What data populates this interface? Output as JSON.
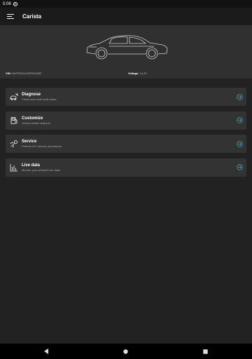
{
  "status_bar": {
    "time": "5:08"
  },
  "app_bar": {
    "title": "Carista",
    "menu_icon": "menu-icon"
  },
  "vehicle": {
    "vin_label": "VIN:",
    "vin_value": "WVPZZALKZ0P943432",
    "voltage_label": "Voltage:",
    "voltage_value": "14.4V"
  },
  "features": [
    {
      "title": "Diagnose",
      "subtitle": "Check and reset fault codes",
      "icon": "car-diagnose-icon"
    },
    {
      "title": "Customize",
      "subtitle": "Unlock hidden features",
      "icon": "fuel-customize-icon"
    },
    {
      "title": "Service",
      "subtitle": "Perform DIY service procedures",
      "icon": "wrench-service-icon"
    },
    {
      "title": "Live data",
      "subtitle": "Monitor your vehicle's live data",
      "icon": "bar-chart-icon"
    }
  ],
  "nav_bar": {
    "back": "back-icon",
    "home": "home-icon",
    "recents": "recents-icon"
  },
  "colors": {
    "accent": "#4fb3c4",
    "background": "#222222",
    "card": "#333333",
    "hero": "#303030"
  }
}
